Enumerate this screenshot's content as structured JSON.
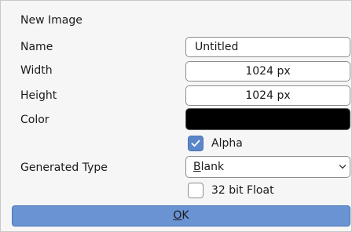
{
  "dialog": {
    "title": "New Image",
    "name_label": "Name",
    "name_value": "Untitled",
    "width_label": "Width",
    "width_value": "1024 px",
    "height_label": "Height",
    "height_value": "1024 px",
    "color_label": "Color",
    "color_value": "#000000",
    "alpha_label": "Alpha",
    "alpha_checked": true,
    "generated_type_label": "Generated Type",
    "generated_type_value_first": "B",
    "generated_type_value_rest": "lank",
    "float_label": "32 bit Float",
    "float_checked": false,
    "ok_label_first": "O",
    "ok_label_rest": "K"
  },
  "icons": {
    "alpha_check": "checkmark-icon",
    "select_chevron": "chevron-down-icon"
  },
  "colors": {
    "accent": "#6a93d3",
    "checkbox_checked": "#5b86c9"
  }
}
